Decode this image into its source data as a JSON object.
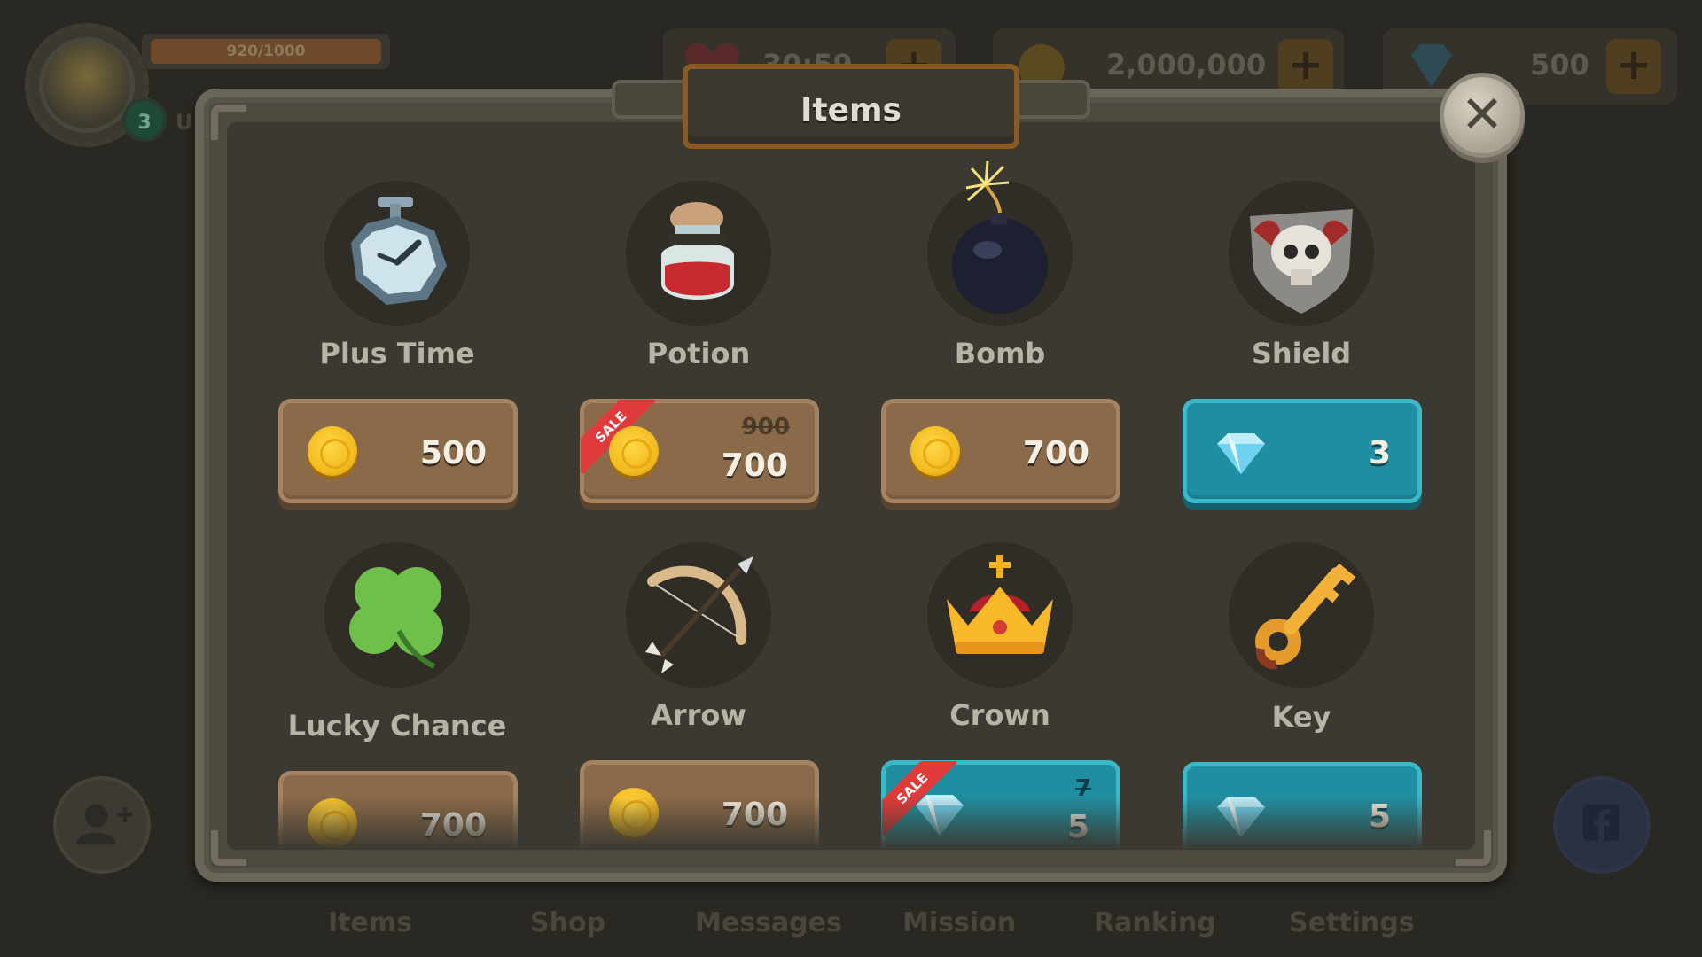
{
  "hud": {
    "xp_text": "920/1000",
    "level": "3",
    "level_label_partial": "U",
    "resources": [
      {
        "icon": "heart-icon",
        "value": "30:59"
      },
      {
        "icon": "coin-icon",
        "value": "2,000,000"
      },
      {
        "icon": "gem-icon",
        "value": "500"
      }
    ],
    "plus_label": "+"
  },
  "bottom_nav": [
    "Items",
    "Shop",
    "Messages",
    "Mission",
    "Ranking",
    "Settings"
  ],
  "modal": {
    "title": "Items",
    "close_label": "✕",
    "sale_label": "SALE",
    "items": [
      {
        "name": "Plus Time",
        "icon": "stopwatch-icon",
        "currency": "coin",
        "price": "500",
        "old_price": null
      },
      {
        "name": "Potion",
        "icon": "potion-icon",
        "currency": "coin",
        "price": "700",
        "old_price": "900"
      },
      {
        "name": "Bomb",
        "icon": "bomb-icon",
        "currency": "coin",
        "price": "700",
        "old_price": null
      },
      {
        "name": "Shield",
        "icon": "shield-icon",
        "currency": "gem",
        "price": "3",
        "old_price": null
      },
      {
        "name": "Lucky Chance",
        "icon": "clover-icon",
        "currency": "coin",
        "price": "700",
        "old_price": null
      },
      {
        "name": "Arrow",
        "icon": "bow-arrow-icon",
        "currency": "coin",
        "price": "700",
        "old_price": null
      },
      {
        "name": "Crown",
        "icon": "crown-icon",
        "currency": "gem",
        "price": "5",
        "old_price": "7"
      },
      {
        "name": "Key",
        "icon": "key-icon",
        "currency": "gem",
        "price": "5",
        "old_price": null
      }
    ]
  },
  "colors": {
    "coin_button": "#8a6a48",
    "gem_button": "#1f8ea0",
    "sale_ribbon": "#e03a3a",
    "title_border": "#8a5a26"
  }
}
